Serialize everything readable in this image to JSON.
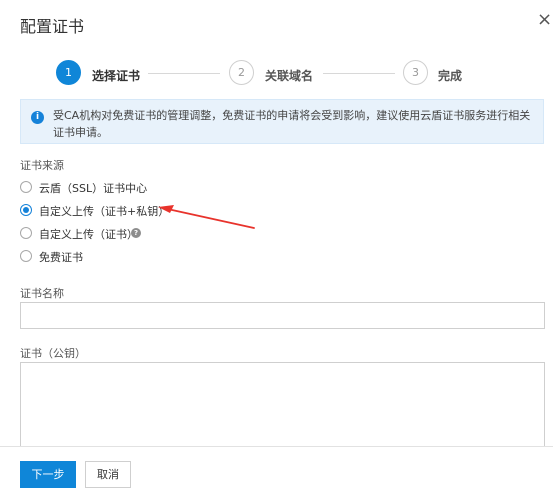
{
  "dialog": {
    "title": "配置证书",
    "close_glyph": "×"
  },
  "steps": [
    {
      "number": "1",
      "label": "选择证书",
      "state": "active"
    },
    {
      "number": "2",
      "label": "关联域名",
      "state": "idle"
    },
    {
      "number": "3",
      "label": "完成",
      "state": "idle"
    }
  ],
  "notice": {
    "icon": "info-icon",
    "icon_glyph": "i",
    "text": "受CA机构对免费证书的管理调整，免费证书的申请将会受到影响，建议使用云盾证书服务进行相关证书申请。"
  },
  "form": {
    "source_label": "证书来源",
    "options": [
      {
        "label": "云盾（SSL）证书中心",
        "checked": false
      },
      {
        "label": "自定义上传（证书+私钥）",
        "checked": true
      },
      {
        "label": "自定义上传（证书）",
        "checked": false,
        "help_glyph": "?"
      },
      {
        "label": "免费证书",
        "checked": false
      }
    ],
    "name_label": "证书名称",
    "name_value": "",
    "cert_label": "证书（公钥）",
    "cert_value": ""
  },
  "footer": {
    "next_label": "下一步",
    "cancel_label": "取消"
  },
  "colors": {
    "primary": "#0f86d8",
    "notice_bg": "#e8f2fb",
    "annotation_arrow": "#e8332c"
  }
}
